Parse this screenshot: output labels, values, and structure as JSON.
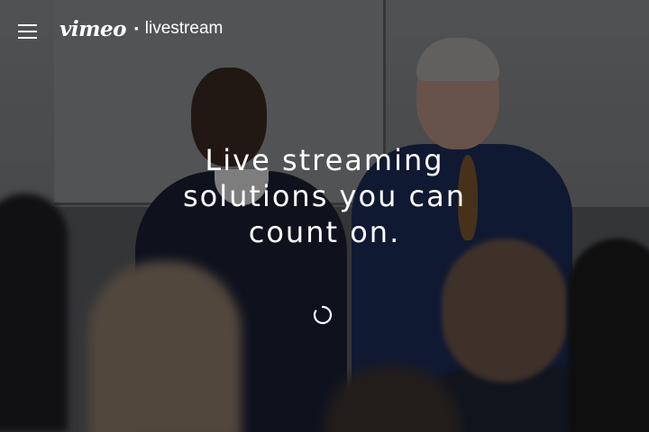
{
  "header": {
    "menu_icon": "hamburger-menu-icon",
    "logo": {
      "brand": "vimeo",
      "separator": "·",
      "product": "livestream"
    }
  },
  "hero": {
    "headline_lines": [
      "Live streaming",
      "solutions you can",
      "count on."
    ],
    "loading_icon": "loading-spinner-icon"
  },
  "colors": {
    "text": "#ffffff",
    "overlay": "rgba(0,0,0,0.42)"
  }
}
